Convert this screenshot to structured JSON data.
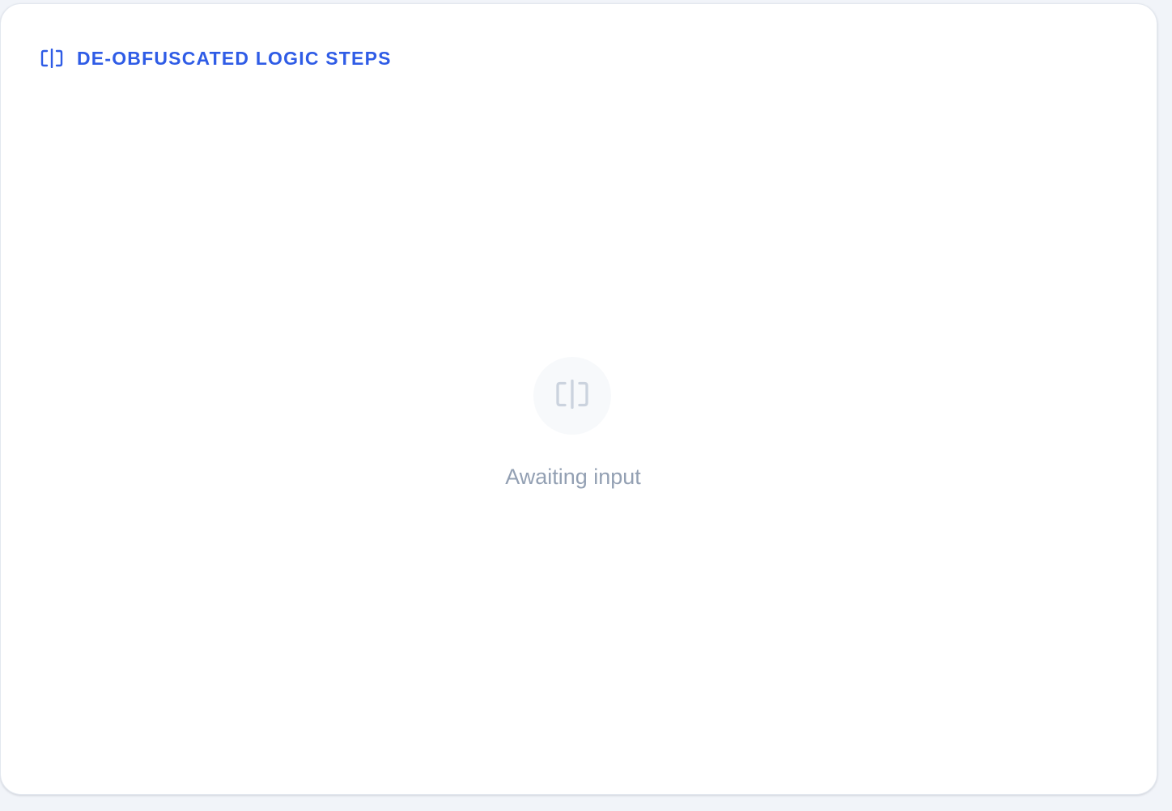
{
  "panel": {
    "title": "DE-OBFUSCATED LOGIC STEPS",
    "icon": "split-view-icon"
  },
  "empty_state": {
    "icon": "split-view-icon",
    "message": "Awaiting input"
  },
  "colors": {
    "accent": "#2f5ce6",
    "muted_text": "#93a0b3",
    "muted_icon": "#cbd3de",
    "page_background": "#f1f4f9",
    "panel_background": "#ffffff"
  }
}
